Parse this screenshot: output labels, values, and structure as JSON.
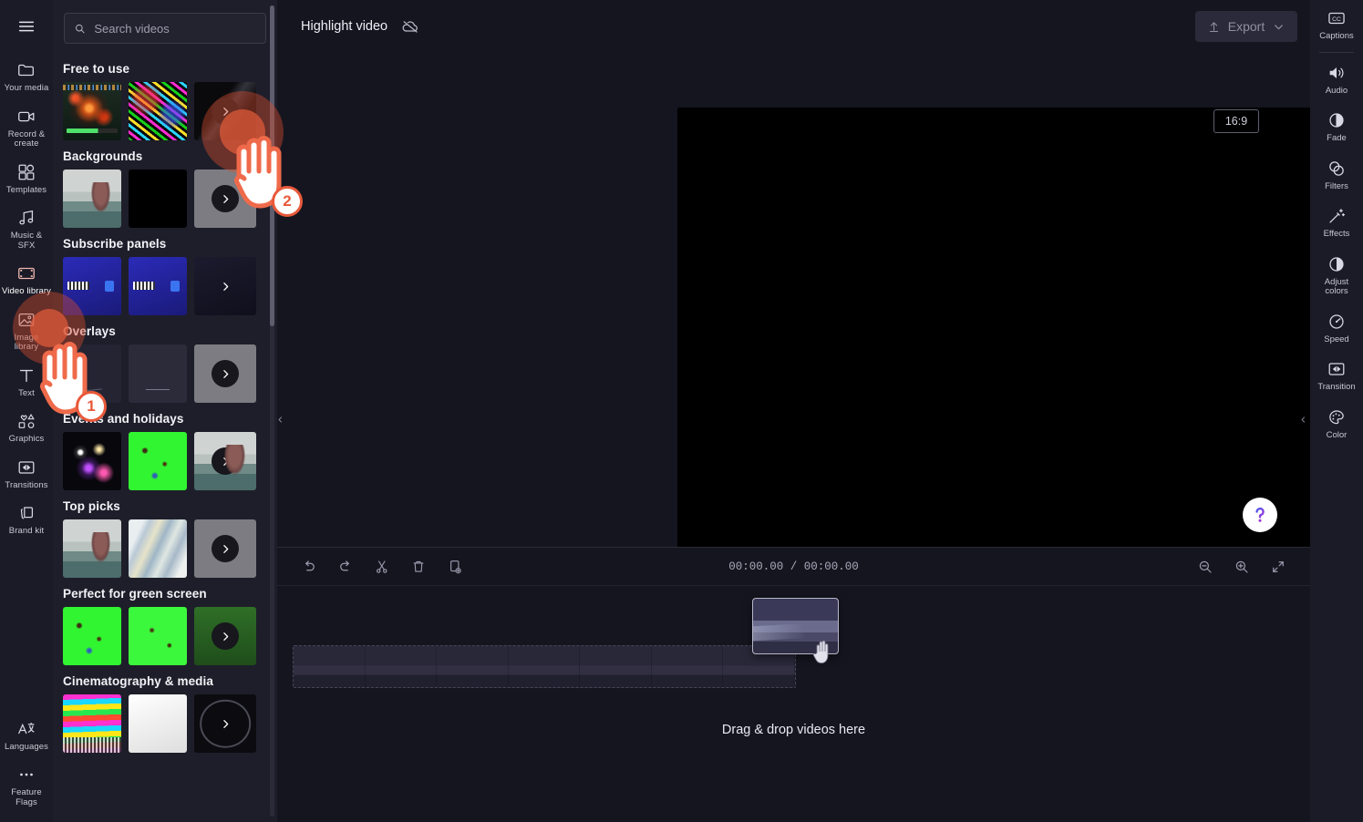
{
  "app": {
    "title": "Highlight video",
    "cloud_status_icon": "cloud-off-icon",
    "export_label": "Export",
    "hamburger_icon": "hamburger-menu-icon"
  },
  "left_rail": {
    "items": [
      {
        "label": "Your media",
        "icon": "folder-icon",
        "active": false
      },
      {
        "label": "Record & create",
        "icon": "video-camera-icon",
        "active": false
      },
      {
        "label": "Templates",
        "icon": "templates-icon",
        "active": false
      },
      {
        "label": "Music & SFX",
        "icon": "music-note-icon",
        "active": false
      },
      {
        "label": "Video library",
        "icon": "film-strip-icon",
        "active": true
      },
      {
        "label": "Image library",
        "icon": "image-icon",
        "active": false
      },
      {
        "label": "Text",
        "icon": "text-t-icon",
        "active": false
      },
      {
        "label": "Graphics",
        "icon": "shapes-icon",
        "active": false
      },
      {
        "label": "Transitions",
        "icon": "transition-icon",
        "active": false
      },
      {
        "label": "Brand kit",
        "icon": "brand-kit-icon",
        "active": false
      }
    ],
    "bottom_items": [
      {
        "label": "Languages",
        "icon": "translate-icon"
      },
      {
        "label": "Feature Flags",
        "icon": "ellipsis-icon"
      }
    ]
  },
  "search": {
    "placeholder": "Search videos",
    "value": "",
    "icon": "search-icon"
  },
  "library": {
    "categories": [
      {
        "title": "Free to use",
        "thumbs": [
          "t-game",
          "t-doodle",
          "t-dark"
        ]
      },
      {
        "title": "Backgrounds",
        "thumbs": [
          "t-lake",
          "t-black",
          "t-grey"
        ]
      },
      {
        "title": "Subscribe panels",
        "thumbs": [
          "t-sub",
          "t-sub",
          "t-subdark"
        ]
      },
      {
        "title": "Overlays",
        "thumbs": [
          "t-overlay1",
          "t-overlay2",
          "t-grey"
        ]
      },
      {
        "title": "Events and holidays",
        "thumbs": [
          "t-fireworks",
          "t-green",
          "t-lake"
        ]
      },
      {
        "title": "Top picks",
        "thumbs": [
          "t-lake",
          "t-marble",
          "t-grey"
        ]
      },
      {
        "title": "Perfect for green screen",
        "thumbs": [
          "t-green",
          "t-green2",
          "t-greendark"
        ]
      },
      {
        "title": "Cinematography & media",
        "thumbs": [
          "t-glitch",
          "t-white",
          "t-countdown"
        ]
      }
    ],
    "more_icon": "chevron-right-icon"
  },
  "preview": {
    "aspect_ratio": "16:9",
    "controls": [
      {
        "name": "skip-to-start-button",
        "icon": "skip-previous-icon"
      },
      {
        "name": "rewind-5s-button",
        "icon": "rewind-5-icon"
      },
      {
        "name": "play-button",
        "icon": "play-icon"
      },
      {
        "name": "forward-5s-button",
        "icon": "forward-5-icon"
      },
      {
        "name": "skip-to-end-button",
        "icon": "skip-next-icon"
      }
    ],
    "fullscreen_icon": "fullscreen-icon",
    "help_icon": "question-mark-icon"
  },
  "timeline": {
    "current_time": "00:00.00",
    "total_time": "00:00.00",
    "time_display": "00:00.00 / 00:00.00",
    "tools": [
      {
        "name": "undo-button",
        "icon": "undo-icon"
      },
      {
        "name": "redo-button",
        "icon": "redo-icon"
      },
      {
        "name": "split-button",
        "icon": "scissors-icon"
      },
      {
        "name": "delete-button",
        "icon": "trash-icon"
      },
      {
        "name": "duplicate-button",
        "icon": "duplicate-icon"
      }
    ],
    "zoom_tools": [
      {
        "name": "zoom-out-button",
        "icon": "zoom-out-icon"
      },
      {
        "name": "zoom-in-button",
        "icon": "zoom-in-icon"
      },
      {
        "name": "fit-timeline-button",
        "icon": "fit-icon"
      }
    ],
    "drop_hint": "Drag & drop videos here"
  },
  "right_rail": {
    "items": [
      {
        "label": "Captions",
        "icon": "closed-captions-icon"
      },
      {
        "label": "Audio",
        "icon": "speaker-icon"
      },
      {
        "label": "Fade",
        "icon": "fade-icon"
      },
      {
        "label": "Filters",
        "icon": "filters-icon"
      },
      {
        "label": "Effects",
        "icon": "magic-wand-icon"
      },
      {
        "label": "Adjust colors",
        "icon": "contrast-icon"
      },
      {
        "label": "Speed",
        "icon": "speedometer-icon"
      },
      {
        "label": "Transition",
        "icon": "transition-icon"
      },
      {
        "label": "Color",
        "icon": "palette-icon"
      }
    ]
  },
  "annotations": [
    {
      "number": "1",
      "target": "Video library"
    },
    {
      "number": "2",
      "target": "Free to use show more"
    }
  ],
  "colors": {
    "app_background": "#15151f",
    "rail_background": "#1b1b27",
    "panel_background": "#1e1e2a",
    "annotation_accent": "#e8593a",
    "text_primary": "#eeeef4",
    "text_secondary": "#9e9eb0"
  }
}
